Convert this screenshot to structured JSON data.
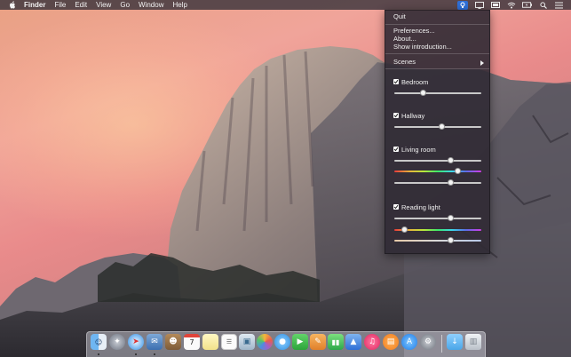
{
  "menubar": {
    "app": "Finder",
    "items": [
      "File",
      "Edit",
      "View",
      "Go",
      "Window",
      "Help"
    ],
    "status_icons": [
      "app-status-icon",
      "airplay-icon",
      "cast-icon",
      "wifi-icon",
      "battery-icon",
      "search-icon",
      "list-icon"
    ]
  },
  "menu": {
    "quit": "Quit",
    "preferences": "Preferences...",
    "about": "About...",
    "intro": "Show introduction...",
    "scenes": "Scenes",
    "rooms": [
      {
        "name": "Bedroom",
        "checked": true,
        "levels": [
          0.33
        ]
      },
      {
        "name": "Hallway",
        "checked": true,
        "levels": [
          0.55
        ]
      },
      {
        "name": "Living room",
        "checked": true,
        "levels": [
          0.65,
          0.73,
          0.65
        ]
      },
      {
        "name": "Reading light",
        "checked": true,
        "levels": [
          0.65,
          0.12,
          0.65
        ]
      }
    ]
  },
  "dock": {
    "apps": [
      "finder-icon",
      "launchpad-icon",
      "safari-icon",
      "mail-icon",
      "contacts-icon",
      "calendar-icon",
      "notes-icon",
      "reminders-icon",
      "preview-icon",
      "photos-icon",
      "messages-icon",
      "facetime-icon",
      "pages-icon",
      "numbers-icon",
      "keynote-icon",
      "itunes-icon",
      "ibooks-icon",
      "app-store-icon",
      "system-preferences-icon",
      "downloads-folder-icon",
      "trash-icon"
    ],
    "calendar_day": "7"
  },
  "colors": {
    "menubar_bg": "#3a343c",
    "menu_bg": "#302a34",
    "highlight": "#2f6fd7"
  }
}
